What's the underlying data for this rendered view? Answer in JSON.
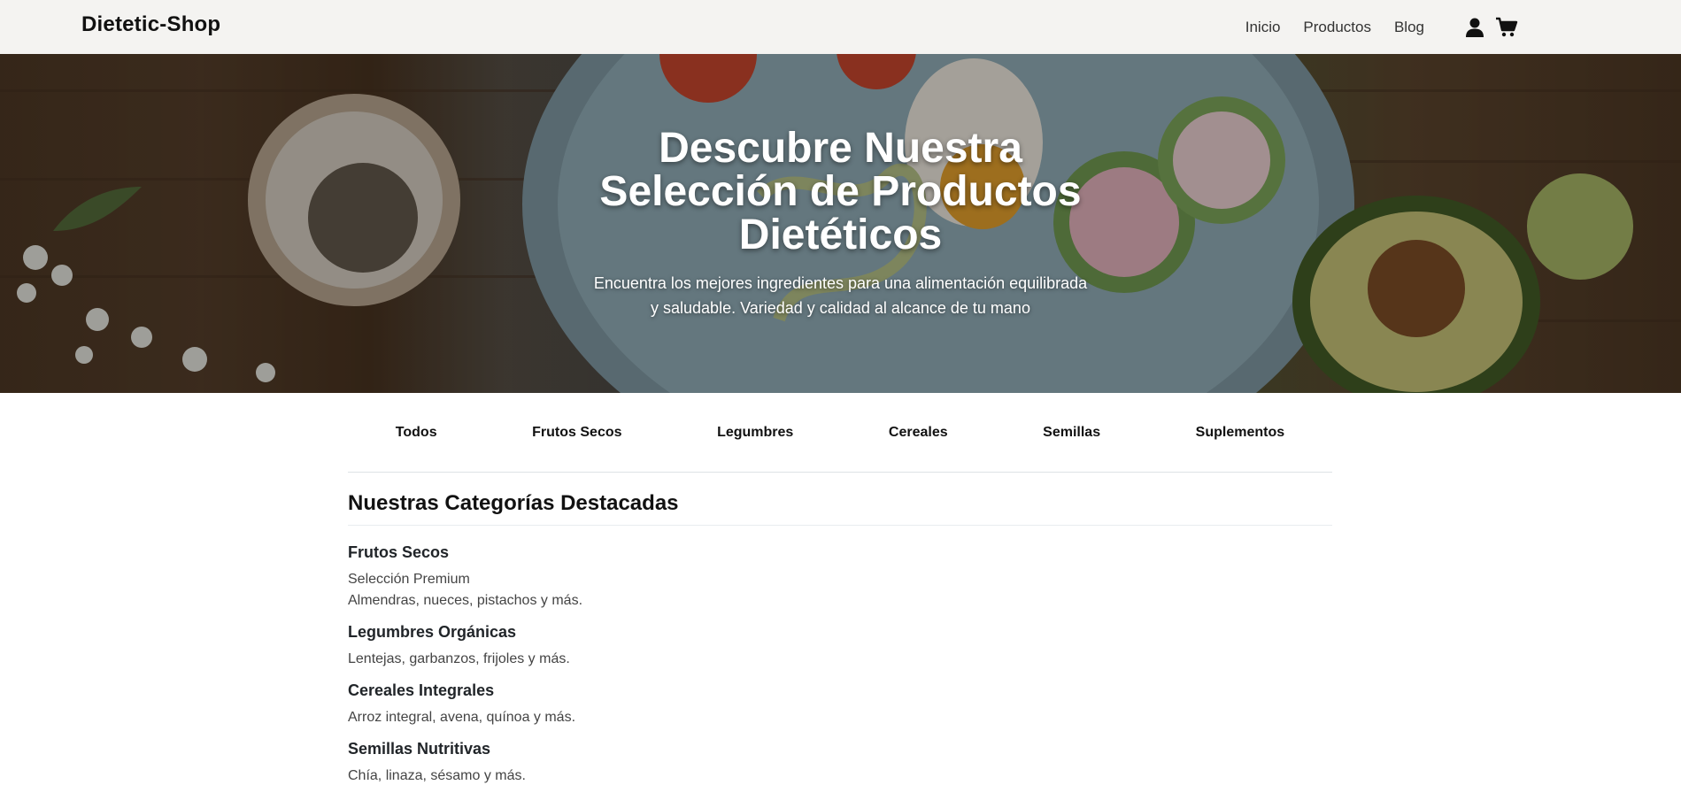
{
  "navbar": {
    "brand": "Dietetic-Shop",
    "links": [
      "Inicio",
      "Productos",
      "Blog"
    ],
    "icons": [
      "user-icon",
      "cart-icon"
    ]
  },
  "hero": {
    "title": "Descubre Nuestra Selección de Productos Dietéticos",
    "subtitle": "Encuentra los mejores ingredientes para una alimentación equilibrada y saludable. Variedad y calidad al alcance de tu mano"
  },
  "tabs": [
    "Todos",
    "Frutos Secos",
    "Legumbres",
    "Cereales",
    "Semillas",
    "Suplementos"
  ],
  "featured": {
    "title": "Nuestras Categorías Destacadas",
    "categories": [
      {
        "name": "Frutos Secos",
        "lines": [
          "Selección Premium",
          "Almendras, nueces, pistachos y más."
        ]
      },
      {
        "name": "Legumbres Orgánicas",
        "lines": [
          "Lentejas, garbanzos, frijoles y más."
        ]
      },
      {
        "name": "Cereales Integrales",
        "lines": [
          "Arroz integral, avena, quínoa y más."
        ]
      },
      {
        "name": "Semillas Nutritivas",
        "lines": [
          "Chía, linaza, sésamo y más."
        ]
      }
    ]
  },
  "colors": {
    "navbar_bg": "#f4f3f1",
    "text_dark": "#111111",
    "divider": "#dee2e6"
  }
}
